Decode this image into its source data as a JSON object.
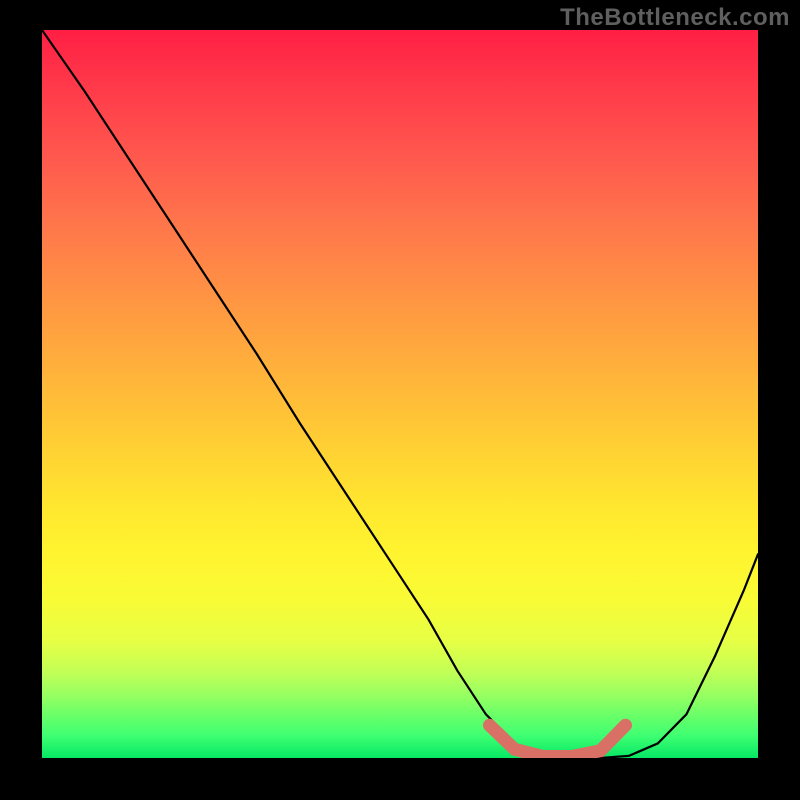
{
  "watermark": "TheBottleneck.com",
  "chart_data": {
    "type": "line",
    "title": "",
    "xlabel": "",
    "ylabel": "",
    "xlim": [
      0,
      1
    ],
    "ylim": [
      0,
      1
    ],
    "note": "Background is a vertical heat gradient from red (top, high bottleneck) to green (bottom, low bottleneck). Black curve shows bottleneck metric vs a normalized parameter; minimum plateau (optimal zone) is highlighted in salmon.",
    "series": [
      {
        "name": "bottleneck-curve",
        "color": "#000000",
        "x": [
          0.0,
          0.06,
          0.12,
          0.18,
          0.24,
          0.3,
          0.36,
          0.42,
          0.48,
          0.54,
          0.58,
          0.62,
          0.66,
          0.7,
          0.74,
          0.78,
          0.82,
          0.86,
          0.9,
          0.94,
          0.98,
          1.0
        ],
        "y": [
          1.0,
          0.915,
          0.825,
          0.735,
          0.645,
          0.555,
          0.46,
          0.37,
          0.28,
          0.19,
          0.12,
          0.06,
          0.02,
          0.003,
          0.0,
          0.0,
          0.003,
          0.02,
          0.06,
          0.14,
          0.23,
          0.28
        ]
      },
      {
        "name": "optimal-zone-marker",
        "color": "#d87066",
        "x": [
          0.625,
          0.66,
          0.7,
          0.74,
          0.78,
          0.815
        ],
        "y": [
          0.045,
          0.012,
          0.002,
          0.002,
          0.01,
          0.045
        ]
      }
    ],
    "gradient_stops": [
      {
        "pos": 0.0,
        "color": "#ff1f44"
      },
      {
        "pos": 0.5,
        "color": "#ffc838"
      },
      {
        "pos": 0.78,
        "color": "#f6ff38"
      },
      {
        "pos": 1.0,
        "color": "#06e765"
      }
    ]
  }
}
